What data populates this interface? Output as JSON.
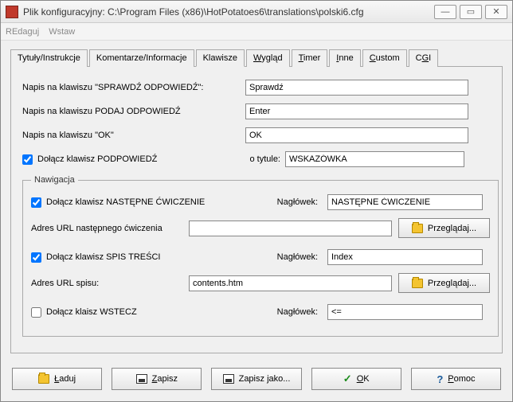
{
  "window": {
    "title": "Plik konfiguracyjny: C:\\Program Files (x86)\\HotPotatoes6\\translations\\polski6.cfg"
  },
  "menu": {
    "edit": "REdaguj",
    "insert": "Wstaw"
  },
  "tabs": {
    "titles": "Tytuły/Instrukcje",
    "comments": "Komentarze/Informacje",
    "keys": "Klawisze",
    "look": "Wygląd",
    "timer": "Timer",
    "other": "Inne",
    "custom": "Custom",
    "cgi": "CGI"
  },
  "fields": {
    "check_label": "Napis na klawiszu \"SPRAWDŹ ODPOWIEDŹ\":",
    "check_value": "Sprawdź",
    "give_label": "Napis na klawiszu PODAJ ODPOWIEDŹ",
    "give_value": "Enter",
    "ok_label": "Napis na klawiszu \"OK\"",
    "ok_value": "OK",
    "hint_chk": "Dołącz klawisz PODPOWIEDŹ",
    "hint_title_lbl": "o tytule:",
    "hint_title_val": "WSKAZÓWKA"
  },
  "nav": {
    "legend": "Nawigacja",
    "next_chk": "Dołącz klawisz NASTĘPNE ĆWICZENIE",
    "header_lbl": "Nagłówek:",
    "next_header": "NASTĘPNE ĆWICZENIE",
    "next_url_lbl": "Adres URL następnego ćwiczenia",
    "next_url_val": "",
    "browse": "Przeglądaj...",
    "toc_chk": "Dołącz klawisz SPIS TREŚCI",
    "toc_header": "Index",
    "toc_url_lbl": "Adres URL spisu:",
    "toc_url_val": "contents.htm",
    "back_chk": "Dołącz klaisz WSTECZ",
    "back_header": "<="
  },
  "footer": {
    "load": "Ładuj",
    "save": "Zapisz",
    "saveas": "Zapisz jako...",
    "ok": "OK",
    "help": "Pomoc"
  }
}
